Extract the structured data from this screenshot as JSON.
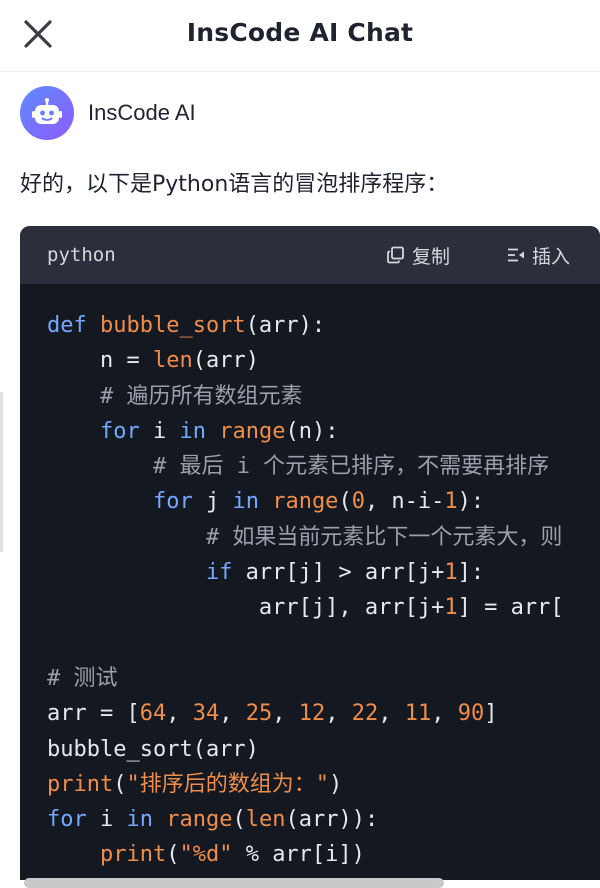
{
  "header": {
    "title": "InsCode AI Chat"
  },
  "message": {
    "sender": "InsCode AI",
    "intro": "好的，以下是Python语言的冒泡排序程序："
  },
  "code_block": {
    "language": "python",
    "copy_label": "复制",
    "insert_label": "插入",
    "lines": [
      [
        [
          "kw",
          "def "
        ],
        [
          "fn",
          "bubble_sort"
        ],
        [
          "p",
          "(arr):"
        ]
      ],
      [
        [
          "p",
          "    n = "
        ],
        [
          "fn",
          "len"
        ],
        [
          "p",
          "(arr)"
        ]
      ],
      [
        [
          "cm",
          "    # 遍历所有数组元素"
        ]
      ],
      [
        [
          "kw",
          "    for"
        ],
        [
          "p",
          " i "
        ],
        [
          "kw",
          "in "
        ],
        [
          "fn",
          "range"
        ],
        [
          "p",
          "(n):"
        ]
      ],
      [
        [
          "cm",
          "        # 最后 i 个元素已排序，不需要再排序"
        ]
      ],
      [
        [
          "kw",
          "        for"
        ],
        [
          "p",
          " j "
        ],
        [
          "kw",
          "in "
        ],
        [
          "fn",
          "range"
        ],
        [
          "p",
          "("
        ],
        [
          "num",
          "0"
        ],
        [
          "p",
          ", n-i-"
        ],
        [
          "num",
          "1"
        ],
        [
          "p",
          "):"
        ]
      ],
      [
        [
          "cm",
          "            # 如果当前元素比下一个元素大，则"
        ]
      ],
      [
        [
          "kw",
          "            if"
        ],
        [
          "p",
          " arr[j] > arr[j+"
        ],
        [
          "num",
          "1"
        ],
        [
          "p",
          "]:"
        ]
      ],
      [
        [
          "p",
          "                arr[j], arr[j+"
        ],
        [
          "num",
          "1"
        ],
        [
          "p",
          "] = arr["
        ]
      ],
      [
        [
          "p",
          ""
        ]
      ],
      [
        [
          "cm",
          "# 测试"
        ]
      ],
      [
        [
          "p",
          "arr = ["
        ],
        [
          "num",
          "64"
        ],
        [
          "p",
          ", "
        ],
        [
          "num",
          "34"
        ],
        [
          "p",
          ", "
        ],
        [
          "num",
          "25"
        ],
        [
          "p",
          ", "
        ],
        [
          "num",
          "12"
        ],
        [
          "p",
          ", "
        ],
        [
          "num",
          "22"
        ],
        [
          "p",
          ", "
        ],
        [
          "num",
          "11"
        ],
        [
          "p",
          ", "
        ],
        [
          "num",
          "90"
        ],
        [
          "p",
          "]"
        ]
      ],
      [
        [
          "p",
          "bubble_sort(arr)"
        ]
      ],
      [
        [
          "fn",
          "print"
        ],
        [
          "p",
          "("
        ],
        [
          "str",
          "\"排序后的数组为：\""
        ],
        [
          "p",
          ")"
        ]
      ],
      [
        [
          "kw",
          "for"
        ],
        [
          "p",
          " i "
        ],
        [
          "kw",
          "in "
        ],
        [
          "fn",
          "range"
        ],
        [
          "p",
          "("
        ],
        [
          "fn",
          "len"
        ],
        [
          "p",
          "(arr)):"
        ]
      ],
      [
        [
          "fn",
          "    print"
        ],
        [
          "p",
          "("
        ],
        [
          "str",
          "\"%d\""
        ],
        [
          "p",
          " % arr[i])"
        ]
      ]
    ]
  },
  "colors": {
    "code_bg": "#141820",
    "code_header_bg": "#2b2f3b",
    "keyword": "#74a8ff",
    "function_number_string": "#f08d49",
    "comment": "#9aa0ab"
  }
}
